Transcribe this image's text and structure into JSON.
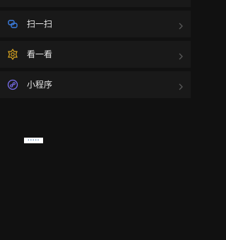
{
  "menu": {
    "items": [
      {
        "label": "扫一扫",
        "icon": "scan-icon",
        "icon_color": "#3b7de0"
      },
      {
        "label": "看一看",
        "icon": "look-icon",
        "icon_color": "#d9a520"
      },
      {
        "label": "小程序",
        "icon": "mini-program-icon",
        "icon_color": "#7a6ff0"
      }
    ]
  },
  "loading": {
    "dots": "•••••"
  },
  "colors": {
    "background": "#111111",
    "row": "#191919",
    "text": "#e6e6e6",
    "chevron": "#5a5a5a"
  }
}
